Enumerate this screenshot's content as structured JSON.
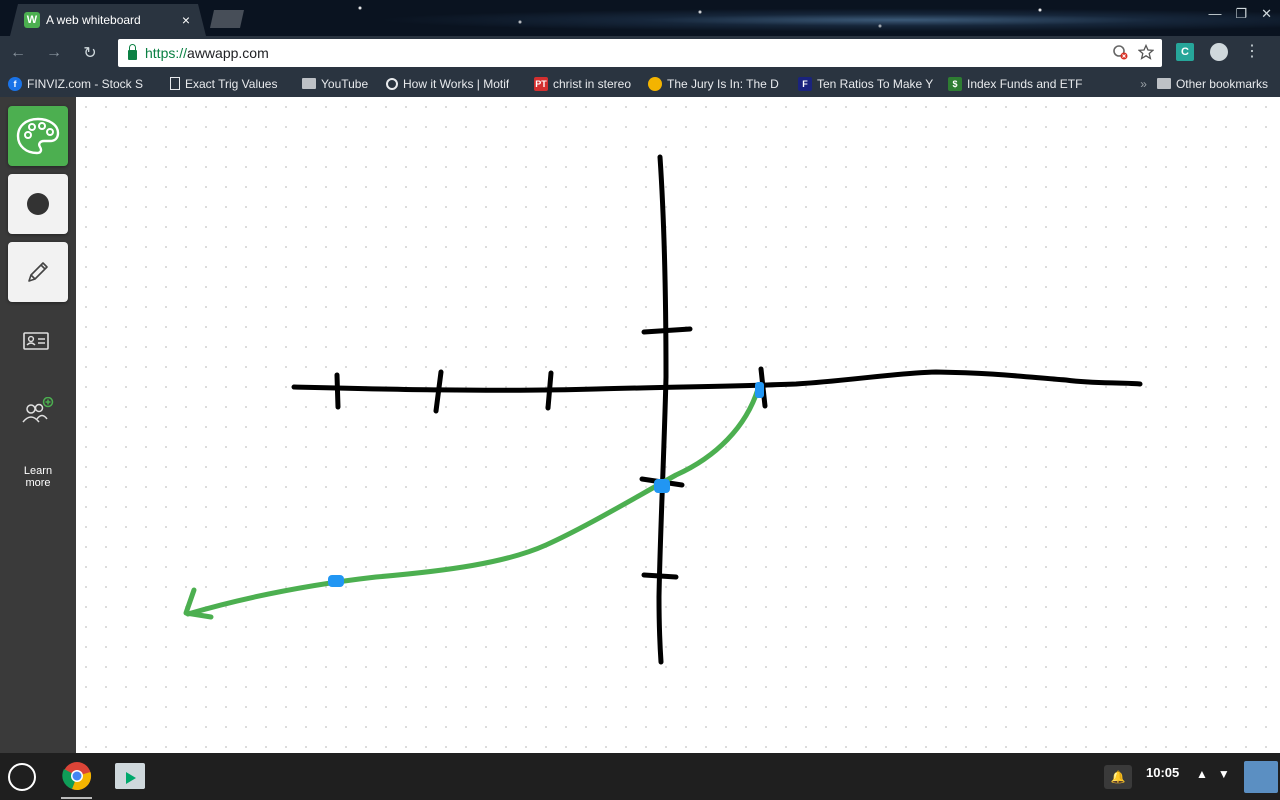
{
  "browser": {
    "tab_title": "A web whiteboard",
    "tab_favicon_letter": "W",
    "close_glyph": "×",
    "url_scheme": "https://",
    "url_host": "awwapp.com",
    "extension_letter": "C",
    "window_controls": [
      "—",
      "❐",
      "✕"
    ]
  },
  "bookmarks": [
    {
      "label": "FINVIZ.com - Stock S",
      "icon": "f",
      "color": "#1a73e8"
    },
    {
      "label": "Exact Trig Values",
      "icon": "page",
      "color": "#e8eaed"
    },
    {
      "label": "YouTube",
      "icon": "folder",
      "color": "#bdc1c6"
    },
    {
      "label": "How it Works | Motif",
      "icon": "o",
      "color": "#555555"
    },
    {
      "label": "christ in stereo",
      "icon": "PT",
      "color": "#d32f2f"
    },
    {
      "label": "The Jury Is In: The D",
      "icon": "face",
      "color": "#f4b400"
    },
    {
      "label": "Ten Ratios To Make Y",
      "icon": "F",
      "color": "#1a237e"
    },
    {
      "label": "Index Funds and ETF",
      "icon": "$",
      "color": "#2e7d32"
    }
  ],
  "bookmarks_more": "»",
  "other_bookmarks": "Other bookmarks",
  "sidebar": {
    "learn_more_line1": "Learn",
    "learn_more_line2": "more",
    "active_color": "#4caf50"
  },
  "whiteboard": {
    "stroke_color_black": "#000000",
    "stroke_color_green": "#4caf50",
    "marker_color_blue": "#2196f3"
  },
  "shelf": {
    "time": "10:05"
  }
}
